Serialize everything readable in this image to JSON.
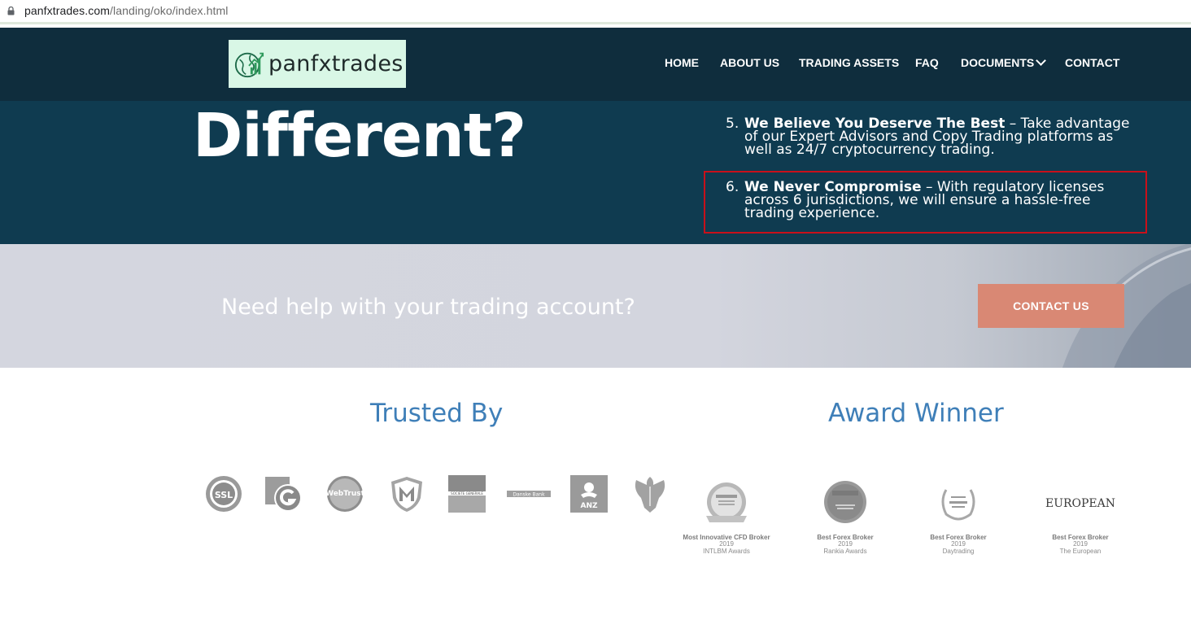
{
  "browser": {
    "url_host": "panfxtrades.com",
    "url_path": "/landing/oko/index.html"
  },
  "nav": {
    "logo_text": "panfxtrades",
    "items": [
      {
        "label": "HOME"
      },
      {
        "label": "ABOUT US"
      },
      {
        "label": "TRADING ASSETS"
      },
      {
        "label": "FAQ"
      },
      {
        "label": "DOCUMENTS"
      },
      {
        "label": "CONTACT"
      }
    ]
  },
  "hero": {
    "heading": "Different?",
    "points": [
      {
        "number": "5.",
        "title": "We Believe You Deserve The Best",
        "text": " – Take advantage of our Expert Advisors and Copy Trading platforms as well as 24/7 cryptocurrency trading."
      },
      {
        "number": "6.",
        "title": "We Never Compromise",
        "text": " – With regulatory licenses across 6 jurisdictions, we will ensure a hassle-free trading experience."
      }
    ],
    "highlight_color": "#c8101a"
  },
  "help_banner": {
    "question": "Need help with your trading account?",
    "button_label": "CONTACT US",
    "button_color": "#d98874"
  },
  "trusted": {
    "heading": "Trusted By",
    "logos": [
      {
        "icon": "ssl-seal-icon",
        "text": "SSL"
      },
      {
        "icon": "g-logo-icon",
        "text": ""
      },
      {
        "icon": "webtrust-icon",
        "text": "WebTrust"
      },
      {
        "icon": "mcafee-shield-icon",
        "text": ""
      },
      {
        "icon": "societe-generale-icon",
        "text": "SOCIETE GENERALE"
      },
      {
        "icon": "danske-bank-icon",
        "text": "Danske Bank"
      },
      {
        "icon": "anz-icon",
        "text": "ANZ"
      },
      {
        "icon": "barclays-eagle-icon",
        "text": ""
      }
    ]
  },
  "awards": {
    "heading": "Award Winner",
    "items": [
      {
        "title": "Most Innovative CFD Broker",
        "year": "2019",
        "source": "INTLBM Awards",
        "icon": "intlbm-medal-icon"
      },
      {
        "title": "Best Forex Broker",
        "year": "2019",
        "source": "Rankia Awards",
        "icon": "rankia-medal-icon"
      },
      {
        "title": "Best Forex Broker",
        "year": "2019",
        "source": "Daytrading",
        "icon": "laurel-badge-icon"
      },
      {
        "title": "Best Forex Broker",
        "year": "2019",
        "source": "The European",
        "icon": "the-european-logo-icon",
        "logo_text": "EUROPEAN"
      }
    ]
  }
}
